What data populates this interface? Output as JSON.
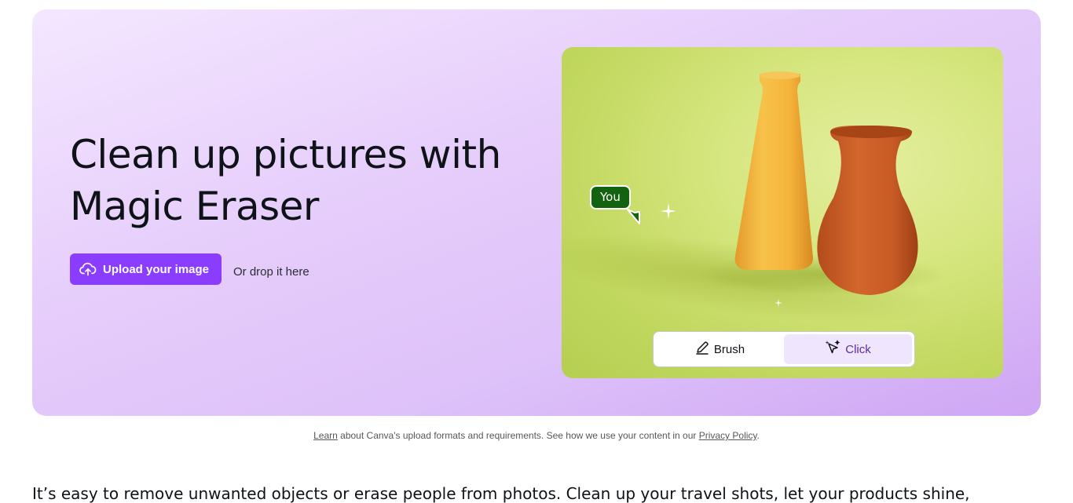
{
  "hero": {
    "title": "Clean up pictures with Magic Eraser",
    "upload_button_label": "Upload your image",
    "upload_icon": "cloud-upload-icon",
    "drop_text": "Or drop it here",
    "colors": {
      "accent": "#8b3dff",
      "banner_start": "#f4e7ff",
      "banner_end": "#cfa6f4",
      "badge": "#12620f"
    }
  },
  "demo": {
    "collaborator_badge": "You",
    "modes": [
      {
        "label": "Brush",
        "icon": "brush-icon",
        "active": false
      },
      {
        "label": "Click",
        "icon": "magic-click-icon",
        "active": true
      }
    ]
  },
  "fineprint": {
    "learn_link": "Learn",
    "text_1": " about Canva's upload formats and requirements. See how we use your content in our ",
    "privacy_link": "Privacy Policy",
    "text_2": "."
  },
  "body": {
    "intro_text": "It’s easy to remove unwanted objects or erase people from photos. Clean up your travel shots, let your products shine,"
  }
}
